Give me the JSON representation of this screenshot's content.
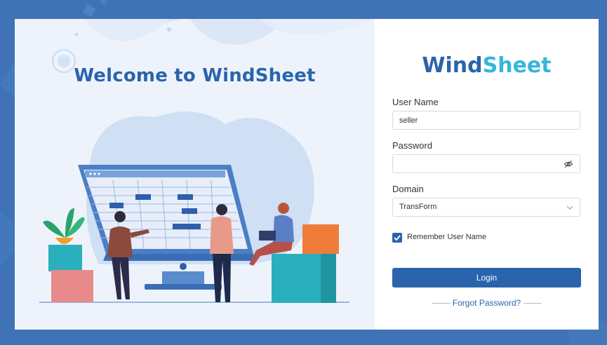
{
  "welcome": {
    "title": "Welcome to WindSheet"
  },
  "logo": {
    "part1": "Wind",
    "part2": "Sheet"
  },
  "form": {
    "username_label": "User Name",
    "username_value": "seller",
    "password_label": "Password",
    "password_value": "",
    "domain_label": "Domain",
    "domain_value": "TransForm",
    "remember_label": "Remember User Name",
    "remember_checked": true,
    "login_label": "Login",
    "forgot_label": "Forgot Password?"
  },
  "icons": {
    "password_toggle": "eye-off-icon",
    "domain_dropdown": "chevron-down-icon",
    "remember_check": "checkmark-icon"
  },
  "colors": {
    "brand": "#2a64ad",
    "accent": "#35b7da",
    "page_bg": "#3f73b5",
    "panel_bg": "#eef3fb"
  }
}
